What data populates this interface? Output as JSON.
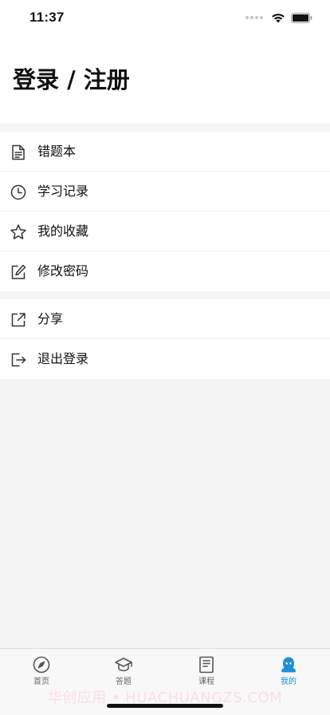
{
  "status_bar": {
    "time": "11:37"
  },
  "header": {
    "login_title": "登录 / 注册"
  },
  "menu_groups": [
    {
      "items": [
        {
          "label": "错题本",
          "icon": "document-icon"
        },
        {
          "label": "学习记录",
          "icon": "clock-icon"
        },
        {
          "label": "我的收藏",
          "icon": "star-icon"
        },
        {
          "label": "修改密码",
          "icon": "edit-icon"
        }
      ]
    },
    {
      "items": [
        {
          "label": "分享",
          "icon": "share-icon"
        },
        {
          "label": "退出登录",
          "icon": "logout-icon"
        }
      ]
    }
  ],
  "tab_bar": {
    "tabs": [
      {
        "label": "首页",
        "icon": "compass-icon",
        "active": false
      },
      {
        "label": "答题",
        "icon": "graduation-cap-icon",
        "active": false
      },
      {
        "label": "课程",
        "icon": "book-icon",
        "active": false
      },
      {
        "label": "我的",
        "icon": "user-icon",
        "active": true
      }
    ]
  },
  "colors": {
    "accent": "#1e8fd6",
    "background": "#f4f4f4",
    "surface": "#ffffff",
    "inactive_tab": "#666666"
  },
  "watermark": {
    "text": "华创应用 • HUACHUANGZS.COM"
  }
}
